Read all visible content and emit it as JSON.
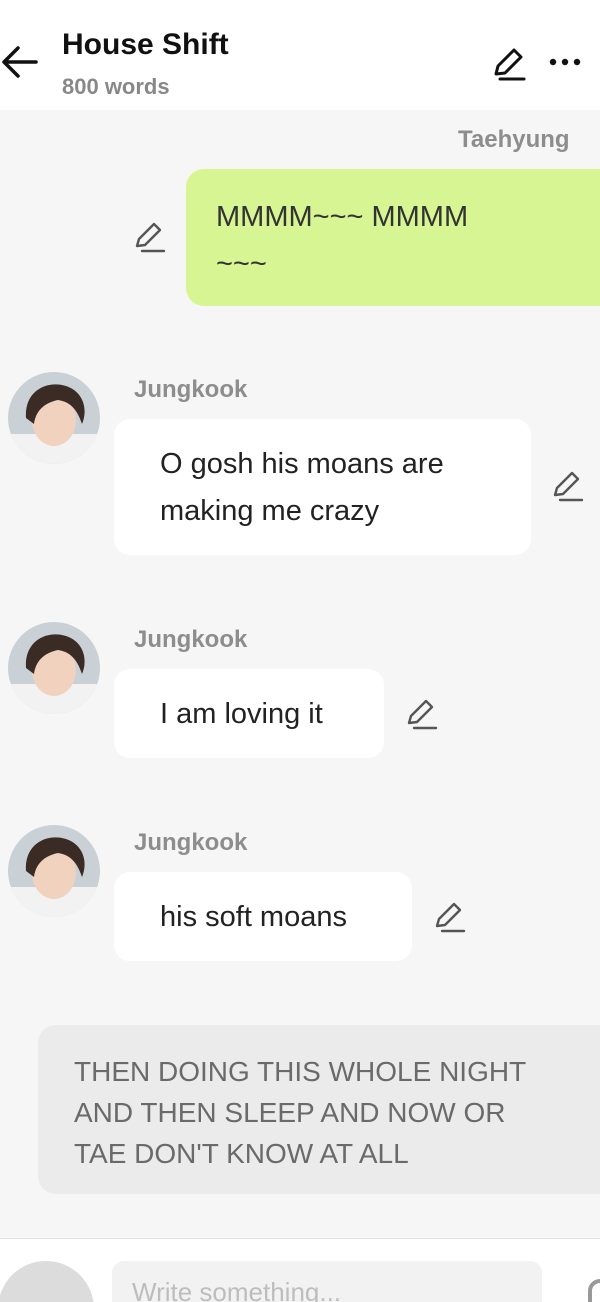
{
  "header": {
    "title": "House Shift",
    "word_count": "800 words",
    "icons": [
      "back-arrow-icon",
      "pencil-icon",
      "more-icon"
    ]
  },
  "messages": [
    {
      "type": "outgoing",
      "sender": "Taehyung",
      "line1": "MMMM~~~ MMMM",
      "line2": "~~~"
    },
    {
      "type": "incoming",
      "sender": "Jungkook",
      "line1": "O gosh his moans are",
      "line2": "making me crazy"
    },
    {
      "type": "incoming",
      "sender": "Jungkook",
      "text": "I am loving it"
    },
    {
      "type": "incoming",
      "sender": "Jungkook",
      "text": "his soft moans"
    }
  ],
  "narration": {
    "line1": "THEN DOING THIS WHOLE NIGHT",
    "line2": "AND THEN SLEEP AND NOW OR",
    "line3": "TAE DON'T KNOW AT ALL"
  },
  "composer": {
    "placeholder": "Write something..."
  },
  "colors": {
    "outgoing_bubble": "#d7f593",
    "incoming_bubble": "#ffffff",
    "narration_bubble": "#ebebeb",
    "background": "#f6f6f6"
  }
}
